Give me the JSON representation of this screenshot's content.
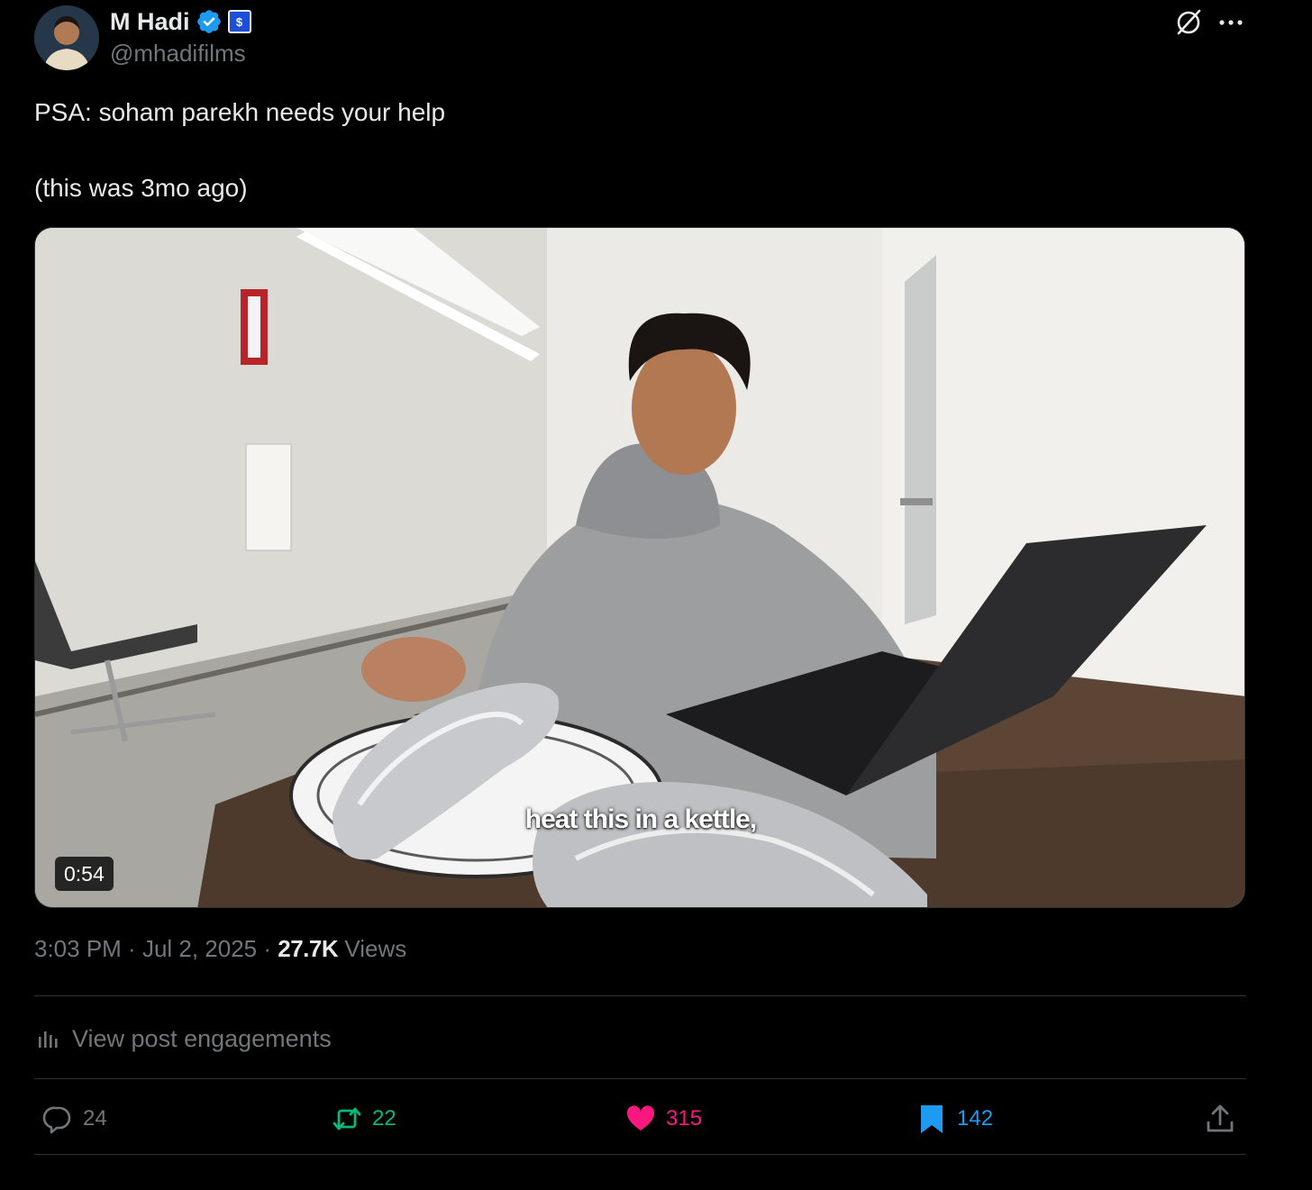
{
  "author": {
    "display_name": "M Hadi",
    "handle": "@mhadifilms",
    "verified_icon": "verified-badge-icon",
    "affiliate_icon": "affiliate-badge-icon",
    "affiliate_glyph": "$"
  },
  "header_actions": {
    "grok_icon": "grok-icon",
    "more_icon": "more-horizontal-icon"
  },
  "tweet": {
    "text_line_1": "PSA: soham parekh needs your help",
    "text_line_2": "(this was 3mo ago)"
  },
  "video": {
    "caption": "heat this in a kettle,",
    "duration": "0:54"
  },
  "meta": {
    "time": "3:03 PM",
    "separator": " · ",
    "date": "Jul 2, 2025",
    "views_count": "27.7K",
    "views_label": " Views"
  },
  "engagements": {
    "label": "View post engagements",
    "icon": "analytics-bars-icon"
  },
  "actions": {
    "reply_count": "24",
    "repost_count": "22",
    "like_count": "315",
    "bookmark_count": "142"
  },
  "colors": {
    "background": "#000000",
    "text_primary": "#e7e9ea",
    "text_secondary": "#71767b",
    "verified_blue": "#1d9bf0",
    "repost_green": "#00ba7c",
    "like_pink": "#f91880",
    "divider": "#2f3336"
  }
}
